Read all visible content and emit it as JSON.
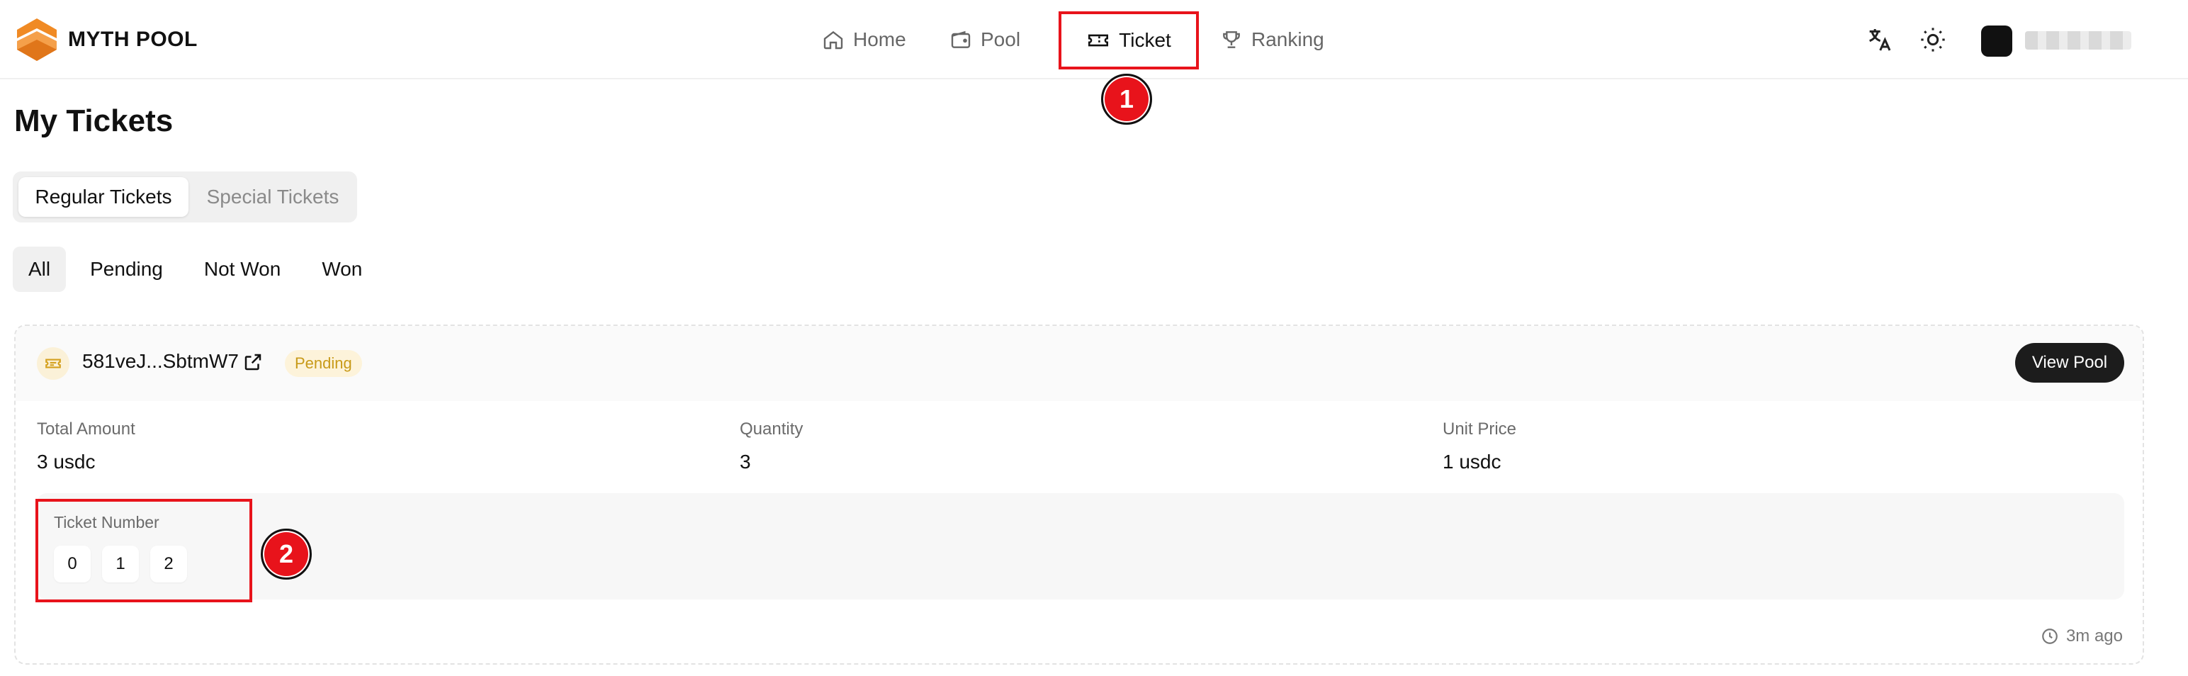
{
  "brand": {
    "name": "MYTH POOL",
    "accent": "#f08a24"
  },
  "nav": {
    "home": "Home",
    "pool": "Pool",
    "ticket": "Ticket",
    "ranking": "Ranking"
  },
  "header": {
    "translate_icon": "translate-icon",
    "theme_icon": "sun-icon"
  },
  "annotations": {
    "marker1": "1",
    "marker2": "2",
    "marker_color": "#e8131b"
  },
  "page": {
    "title": "My Tickets"
  },
  "ticket_type_tabs": {
    "regular": "Regular Tickets",
    "special": "Special Tickets"
  },
  "filters": {
    "all": "All",
    "pending": "Pending",
    "not_won": "Not Won",
    "won": "Won"
  },
  "card": {
    "pool_id": "581veJ...SbtmW7",
    "status": "Pending",
    "view_button": "View Pool",
    "stats": [
      {
        "label": "Total Amount",
        "value": "3 usdc"
      },
      {
        "label": "Quantity",
        "value": "3"
      },
      {
        "label": "Unit Price",
        "value": "1 usdc"
      }
    ],
    "ticket_number_label": "Ticket Number",
    "ticket_numbers": [
      "0",
      "1",
      "2"
    ],
    "time": "3m ago"
  }
}
